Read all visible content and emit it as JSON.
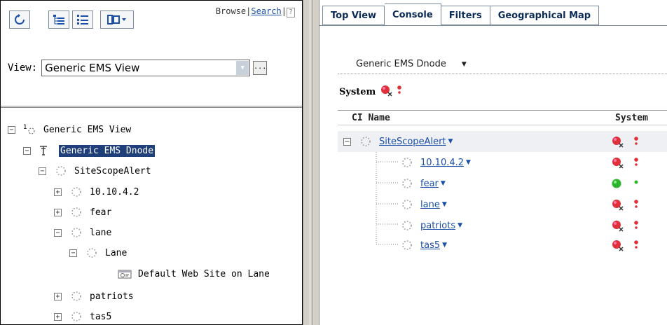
{
  "toolbar": {
    "buttons": [
      {
        "icon": "refresh-icon"
      },
      {
        "icon": "hierarchy-view-icon"
      },
      {
        "icon": "list-view-icon"
      },
      {
        "icon": "layout-menu-icon"
      }
    ],
    "browse_label": "Browse",
    "separator": "|",
    "search_label": "Search",
    "help_label": "?"
  },
  "view_selector": {
    "label": "View:",
    "value": "Generic EMS View",
    "more_label": "..."
  },
  "tree": [
    {
      "label": "Generic EMS View",
      "toggle": "−",
      "icon": "view-root-icon"
    },
    {
      "label": "Generic EMS Dnode",
      "toggle": "−",
      "icon": "dnode-icon",
      "selected": true
    },
    {
      "label": "SiteScopeAlert",
      "toggle": "−",
      "icon": "ci-node-icon"
    },
    {
      "label": "10.10.4.2",
      "toggle": "+",
      "icon": "ci-node-icon"
    },
    {
      "label": "fear",
      "toggle": "+",
      "icon": "ci-node-icon"
    },
    {
      "label": "lane",
      "toggle": "−",
      "icon": "ci-node-icon"
    },
    {
      "label": "Lane",
      "toggle": "−",
      "icon": "ci-node-icon"
    },
    {
      "label": "Default Web Site on Lane",
      "toggle": "",
      "icon": "web-site-icon"
    },
    {
      "label": "patriots",
      "toggle": "+",
      "icon": "ci-node-icon"
    },
    {
      "label": "tas5",
      "toggle": "+",
      "icon": "ci-node-icon"
    }
  ],
  "tabs": [
    "Top View",
    "Console",
    "Filters",
    "Geographical Map"
  ],
  "active_tab": "Console",
  "console": {
    "dnode_label": "Generic EMS Dnode",
    "system_label": "System",
    "columns": {
      "ci_name": "CI Name",
      "system": "System"
    },
    "rows": [
      {
        "name": "SiteScopeAlert",
        "status": "critical"
      },
      {
        "name": "10.10.4.2",
        "status": "critical"
      },
      {
        "name": "fear",
        "status": "ok"
      },
      {
        "name": "lane",
        "status": "critical"
      },
      {
        "name": "patriots",
        "status": "critical"
      },
      {
        "name": "tas5",
        "status": "critical"
      }
    ]
  },
  "colors": {
    "selection": "#1f3f7a",
    "link": "#1b4fa8",
    "critical": "#e0303a",
    "ok": "#2db42d",
    "tab_text": "#0b2b55"
  }
}
